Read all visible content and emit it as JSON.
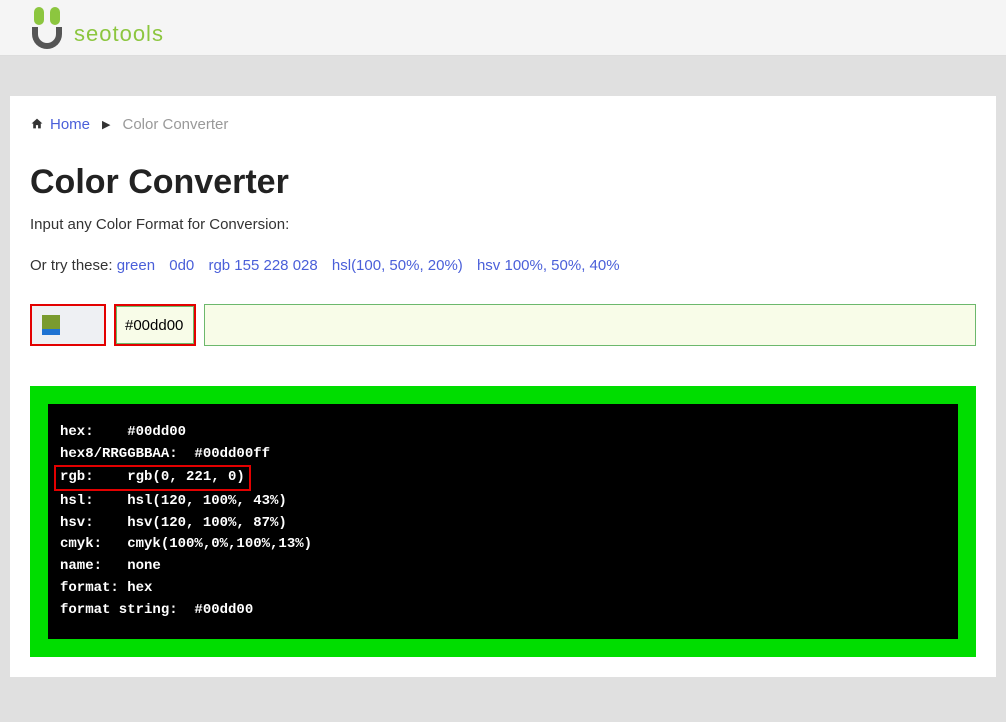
{
  "brand": {
    "text": "seotools"
  },
  "breadcrumb": {
    "home": "Home",
    "current": "Color Converter"
  },
  "page": {
    "title": "Color Converter",
    "subtitle": "Input any Color Format for Conversion:",
    "try_label": "Or try these:",
    "examples": [
      "green",
      "0d0",
      "rgb 155 228 028",
      "hsl(100, 50%, 20%)",
      "hsv 100%, 50%, 40%"
    ]
  },
  "input": {
    "value": "#00dd00"
  },
  "result": {
    "accent_color": "#00dd00",
    "lines": {
      "hex": "hex:    #00dd00",
      "hex8": "hex8/RRGGBBAA:  #00dd00ff",
      "rgb": "rgb:    rgb(0, 221, 0)",
      "hsl": "hsl:    hsl(120, 100%, 43%)",
      "hsv": "hsv:    hsv(120, 100%, 87%)",
      "cmyk": "cmyk:   cmyk(100%,0%,100%,13%)",
      "name": "name:   none",
      "fmt": "format: hex",
      "fmts": "format string:  #00dd00"
    }
  }
}
